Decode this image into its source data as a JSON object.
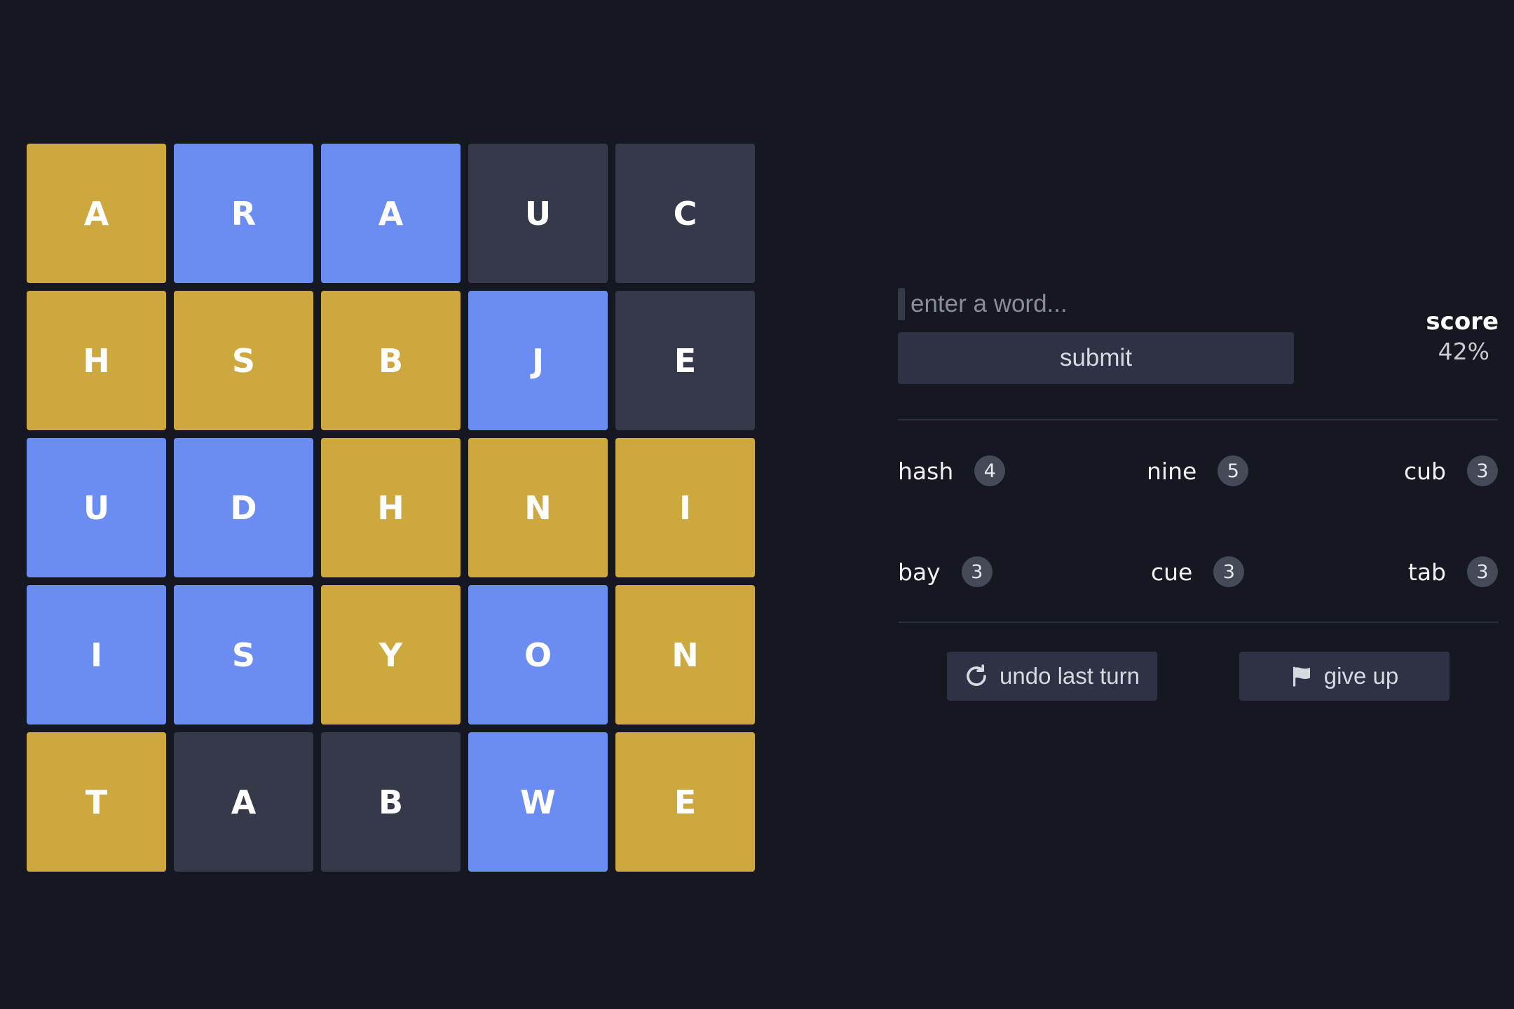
{
  "board": {
    "tiles": [
      {
        "letter": "A",
        "color": "gold"
      },
      {
        "letter": "R",
        "color": "blue"
      },
      {
        "letter": "A",
        "color": "blue"
      },
      {
        "letter": "U",
        "color": "dark"
      },
      {
        "letter": "C",
        "color": "dark"
      },
      {
        "letter": "H",
        "color": "gold"
      },
      {
        "letter": "S",
        "color": "gold"
      },
      {
        "letter": "B",
        "color": "gold"
      },
      {
        "letter": "J",
        "color": "blue"
      },
      {
        "letter": "E",
        "color": "dark"
      },
      {
        "letter": "U",
        "color": "blue"
      },
      {
        "letter": "D",
        "color": "blue"
      },
      {
        "letter": "H",
        "color": "gold"
      },
      {
        "letter": "N",
        "color": "gold"
      },
      {
        "letter": "I",
        "color": "gold"
      },
      {
        "letter": "I",
        "color": "blue"
      },
      {
        "letter": "S",
        "color": "blue"
      },
      {
        "letter": "Y",
        "color": "gold"
      },
      {
        "letter": "O",
        "color": "blue"
      },
      {
        "letter": "N",
        "color": "gold"
      },
      {
        "letter": "T",
        "color": "gold"
      },
      {
        "letter": "A",
        "color": "dark"
      },
      {
        "letter": "B",
        "color": "dark"
      },
      {
        "letter": "W",
        "color": "blue"
      },
      {
        "letter": "E",
        "color": "gold"
      }
    ]
  },
  "colors": {
    "gold": "#cca83e",
    "blue": "#6b8cf0",
    "dark": "#363949",
    "background": "#151821",
    "button": "#2f3244"
  },
  "input": {
    "placeholder": "enter a word...",
    "value": ""
  },
  "submit_label": "submit",
  "score": {
    "label": "score",
    "value": "42%"
  },
  "found_words": [
    {
      "word": "hash",
      "count": "4"
    },
    {
      "word": "nine",
      "count": "5"
    },
    {
      "word": "cub",
      "count": "3"
    },
    {
      "word": "bay",
      "count": "3"
    },
    {
      "word": "cue",
      "count": "3"
    },
    {
      "word": "tab",
      "count": "3"
    }
  ],
  "actions": {
    "undo_label": "undo last turn",
    "undo_icon": "undo-arrow-icon",
    "give_up_label": "give up",
    "give_up_icon": "flag-icon"
  }
}
